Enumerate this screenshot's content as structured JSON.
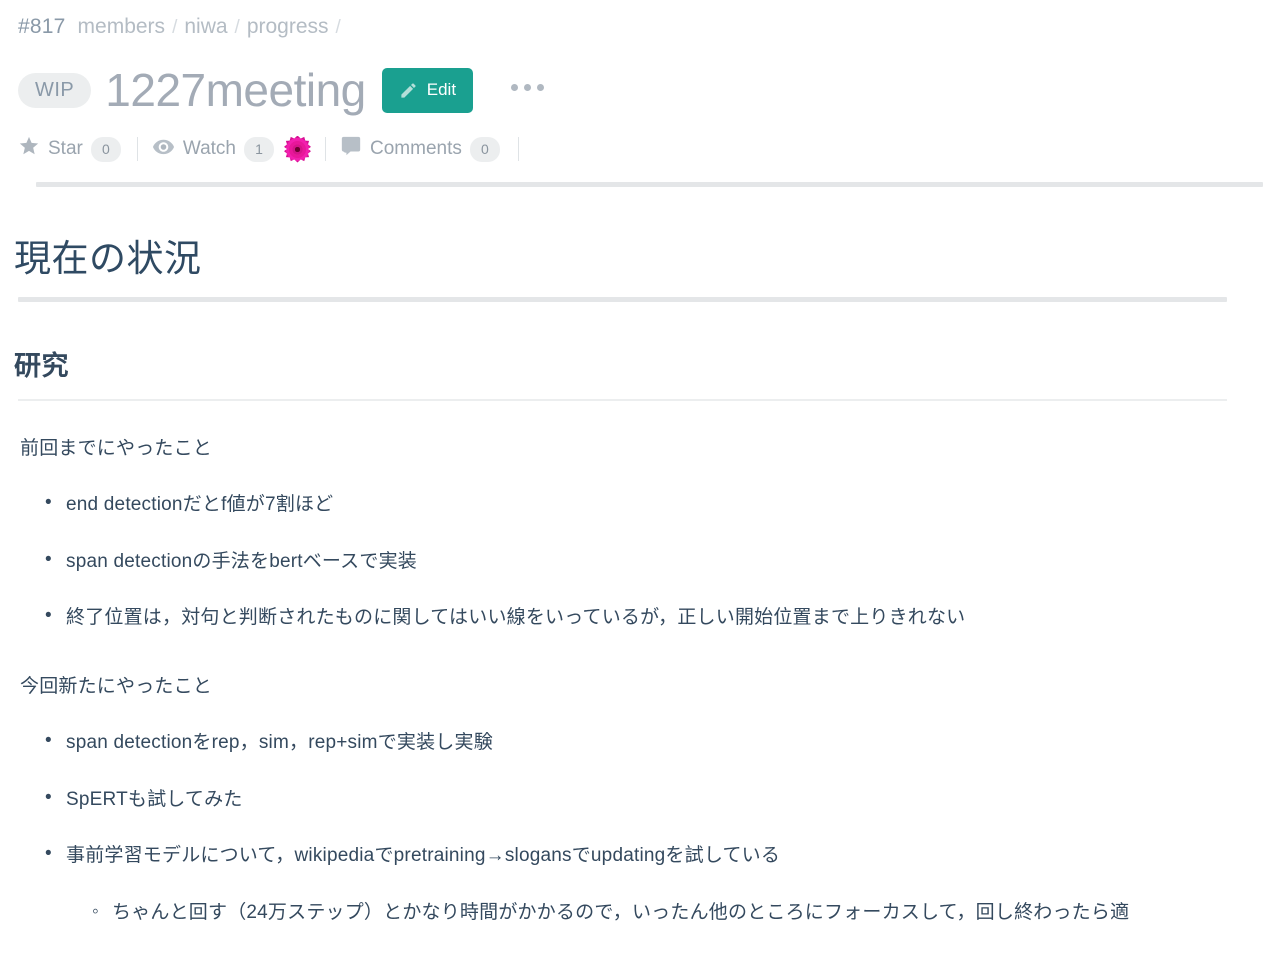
{
  "header": {
    "page_id": "#817",
    "breadcrumbs": [
      {
        "label": "members"
      },
      {
        "label": "niwa"
      },
      {
        "label": "progress"
      }
    ],
    "separator": "/",
    "status_badge": "WIP",
    "title": "1227meeting",
    "edit_label": "Edit",
    "more_menu": "…"
  },
  "meta": {
    "star_label": "Star",
    "star_count": "0",
    "watch_label": "Watch",
    "watch_count": "1",
    "comments_label": "Comments",
    "comments_count": "0"
  },
  "content": {
    "h1": "現在の状況",
    "h2": "研究",
    "para1": "前回までにやったこと",
    "list1": [
      "end detectionだとf値が7割ほど",
      "span detectionの手法をbertベースで実装",
      "終了位置は，対句と判断されたものに関してはいい線をいっているが，正しい開始位置まで上りきれない"
    ],
    "para2": "今回新たにやったこと",
    "list2": [
      "span detectionをrep，sim，rep+simで実装し実験",
      "SpERTも試してみた",
      "事前学習モデルについて，wikipediaでpretraining→slogansでupdatingを試している"
    ],
    "list2_nested": [
      "ちゃんと回す（24万ステップ）とかなり時間がかかるので，いったん他のところにフォーカスして，回し終わったら適"
    ]
  },
  "colors": {
    "accent_teal": "#1aa090",
    "title_gray": "#a3abb6",
    "heading_navy": "#2f4a63",
    "body_slate": "#34495e",
    "rule_gray": "#e4e6e8",
    "avatar_pink": "#e8179a"
  }
}
